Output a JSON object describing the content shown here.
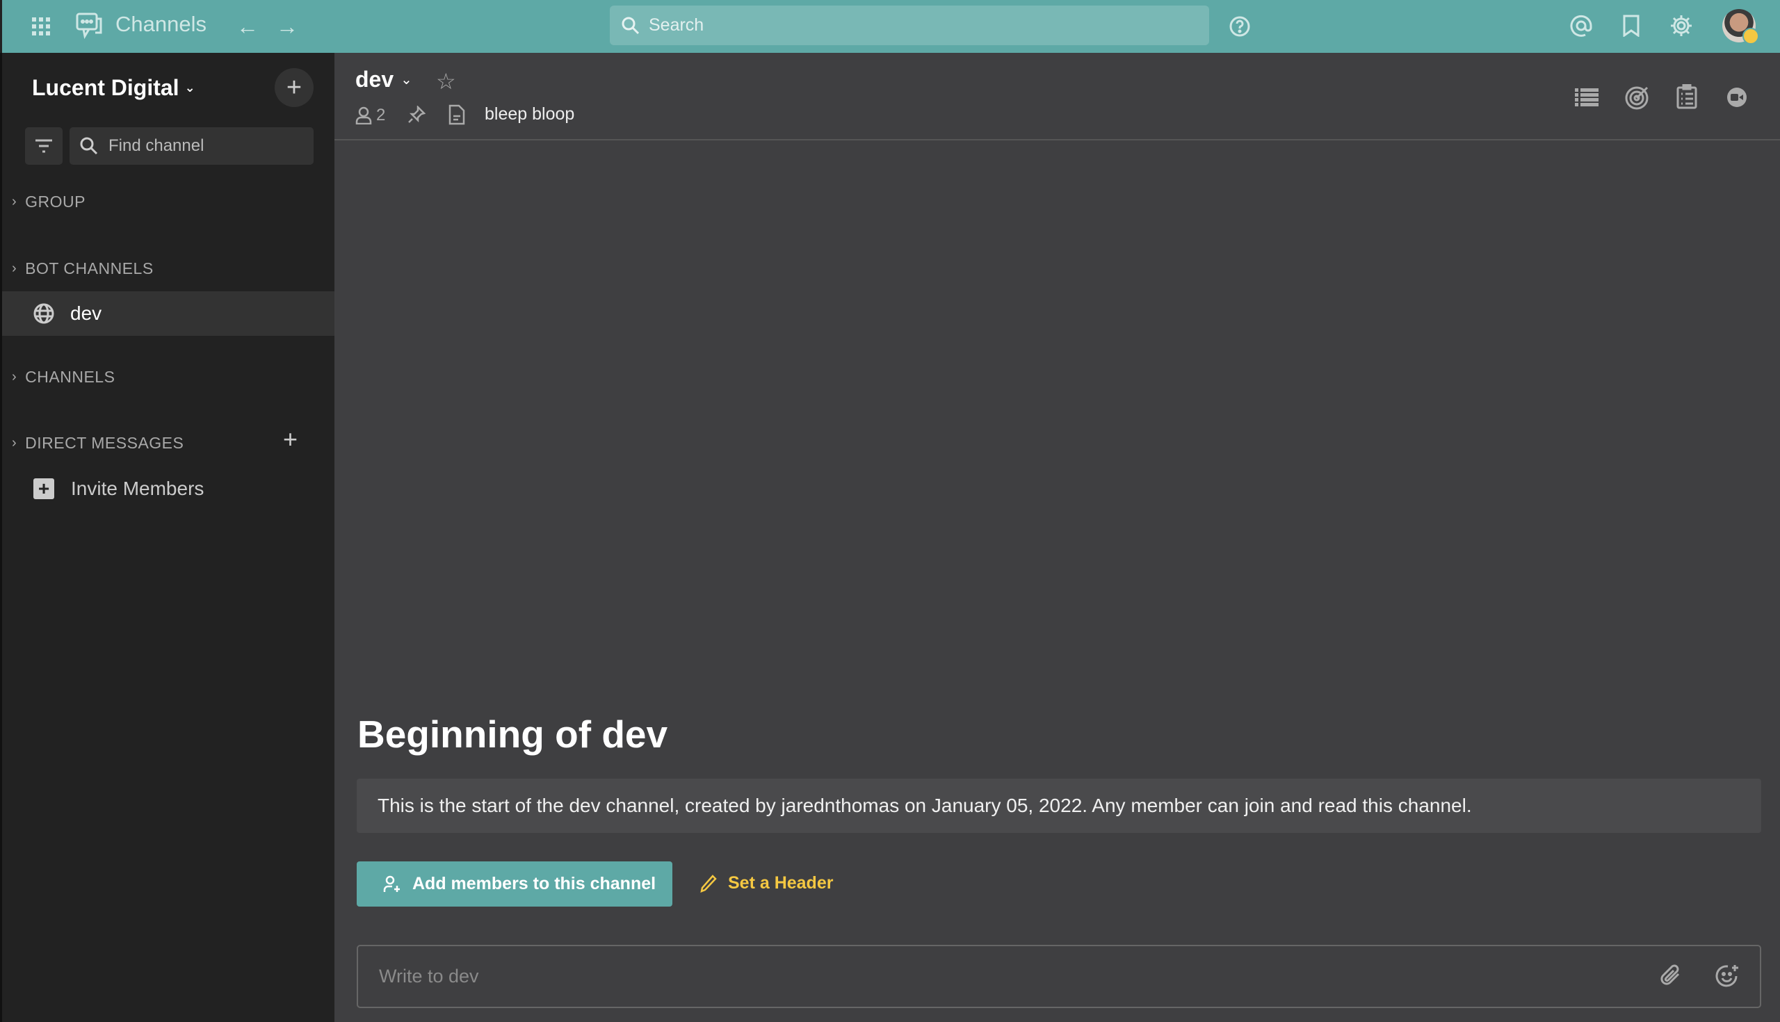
{
  "topbar": {
    "app_title": "Channels",
    "search_placeholder": "Search"
  },
  "sidebar": {
    "team_name": "Lucent Digital",
    "find_placeholder": "Find channel",
    "sections": [
      {
        "label": "GROUP"
      },
      {
        "label": "BOT CHANNELS",
        "items": [
          {
            "label": "dev"
          }
        ]
      },
      {
        "label": "CHANNELS"
      },
      {
        "label": "DIRECT MESSAGES"
      }
    ],
    "invite_label": "Invite Members"
  },
  "channel": {
    "name": "dev",
    "member_count": "2",
    "header_text": "bleep bloop"
  },
  "intro": {
    "title": "Beginning of dev",
    "description": "This is the start of the dev channel, created by jarednthomas on January 05, 2022. Any member can join and read this channel.",
    "add_members_label": "Add members to this channel",
    "set_header_label": "Set a Header"
  },
  "composer": {
    "placeholder": "Write to dev"
  },
  "colors": {
    "accent": "#5ea9a6",
    "sidebar": "#222222",
    "main": "#3f3f41",
    "link": "#f5c842"
  }
}
